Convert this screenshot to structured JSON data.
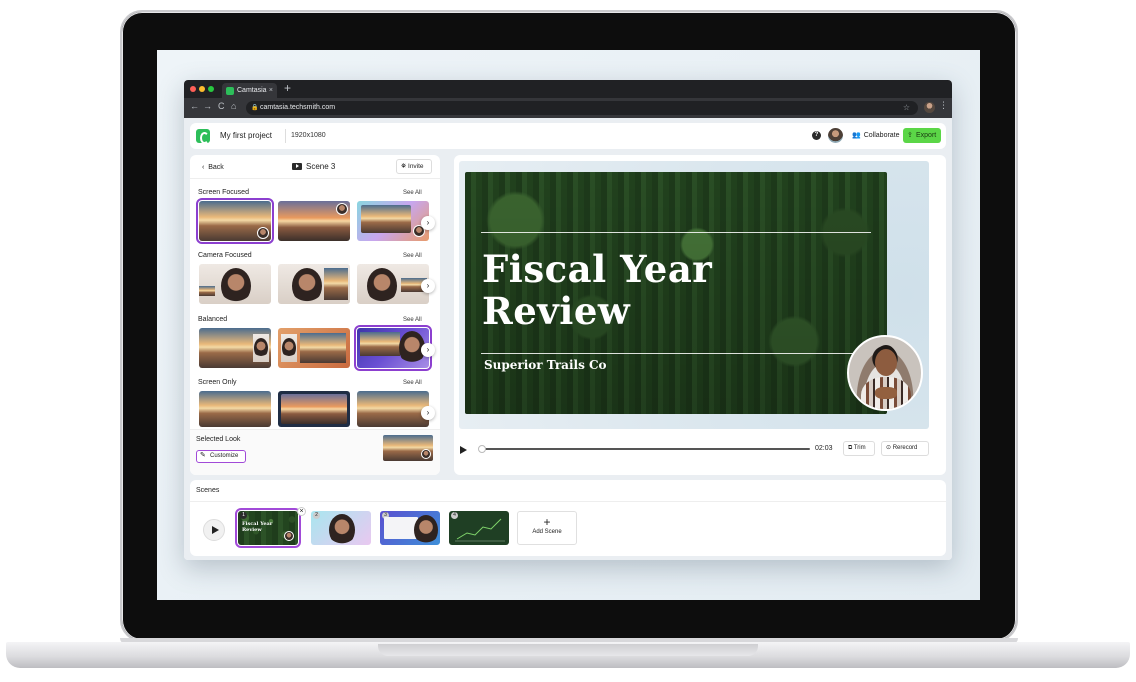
{
  "browser": {
    "tab_title": "Camtasia",
    "tab_close": "×",
    "new_tab": "+",
    "url": "camtasia.techsmith.com",
    "nav": {
      "back": "←",
      "forward": "→",
      "reload": "C",
      "home": "⌂"
    },
    "lock": "🔒",
    "star": "☆",
    "menu": "⋮"
  },
  "topbar": {
    "project_name": "My first project",
    "resolution": "1920x1080",
    "help": "?",
    "collaborate_label": "Collaborate",
    "export_label": "Export"
  },
  "left_panel": {
    "back_label": "Back",
    "scene_title": "Scene 3",
    "invite_label": "Invite",
    "sections": [
      {
        "title": "Screen Focused",
        "see_all": "See All"
      },
      {
        "title": "Camera Focused",
        "see_all": "See All"
      },
      {
        "title": "Balanced",
        "see_all": "See All"
      },
      {
        "title": "Screen Only",
        "see_all": "See All"
      }
    ],
    "selected_look_label": "Selected Look",
    "customize_label": "Customize"
  },
  "preview": {
    "headline_line1": "Fiscal Year",
    "headline_line2": "Review",
    "subline": "Superior Trails Co",
    "time": "02:03",
    "trim_label": "Trim",
    "rerecord_label": "Rerecord"
  },
  "scenes": {
    "label": "Scenes",
    "items": [
      {
        "number": "1",
        "title_line1": "Fiscal Year",
        "title_line2": "Review",
        "active": true
      },
      {
        "number": "2"
      },
      {
        "number": "3"
      },
      {
        "number": "4"
      }
    ],
    "add_label": "Add Scene",
    "add_symbol": "+"
  },
  "icons": [
    "camtasia-logo-icon",
    "play-icon",
    "chevron-right-icon",
    "pencil-icon",
    "users-icon",
    "upload-icon",
    "film-icon",
    "trim-icon",
    "record-icon"
  ],
  "colors": {
    "accent_green": "#5bd647",
    "brand_green": "#2dbe5a",
    "selection_purple": "#a14ad8"
  }
}
